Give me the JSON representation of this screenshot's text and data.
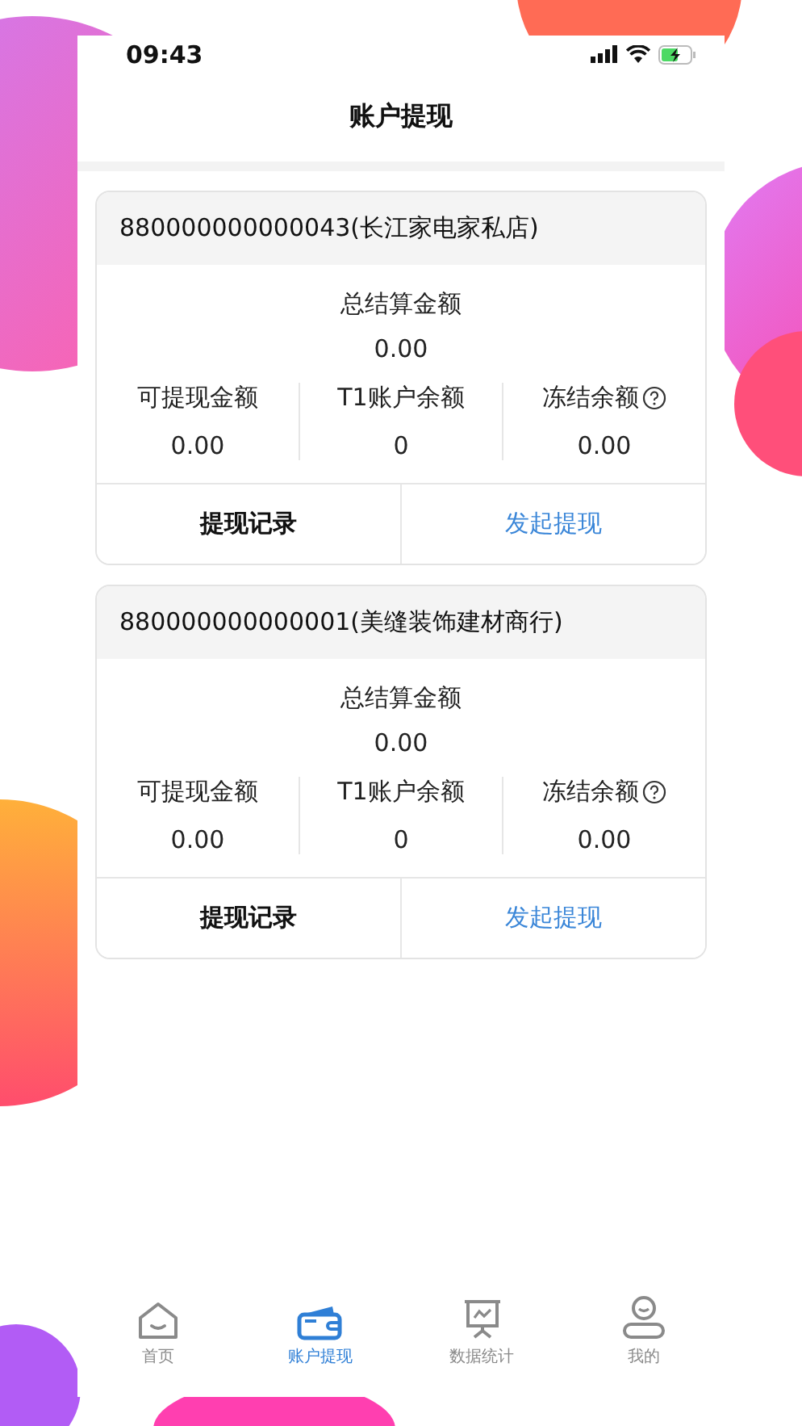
{
  "status_bar": {
    "time": "09:43"
  },
  "header": {
    "title": "账户提现"
  },
  "accounts": [
    {
      "name": "880000000000043(长江家电家私店)",
      "total_label": "总结算金额",
      "total_value": "0.00",
      "stats": [
        {
          "label": "可提现金额",
          "value": "0.00",
          "help": false
        },
        {
          "label": "T1账户余额",
          "value": "0",
          "help": false
        },
        {
          "label": "冻结余额",
          "value": "0.00",
          "help": true
        }
      ],
      "actions": [
        {
          "label": "提现记录",
          "primary": false
        },
        {
          "label": "发起提现",
          "primary": true
        }
      ]
    },
    {
      "name": "880000000000001(美缝装饰建材商行)",
      "total_label": "总结算金额",
      "total_value": "0.00",
      "stats": [
        {
          "label": "可提现金额",
          "value": "0.00",
          "help": false
        },
        {
          "label": "T1账户余额",
          "value": "0",
          "help": false
        },
        {
          "label": "冻结余额",
          "value": "0.00",
          "help": true
        }
      ],
      "actions": [
        {
          "label": "提现记录",
          "primary": false
        },
        {
          "label": "发起提现",
          "primary": true
        }
      ]
    }
  ],
  "tab_bar": [
    {
      "label": "首页",
      "kind": "home",
      "selected": false
    },
    {
      "label": "账户提现",
      "kind": "wallet",
      "selected": true
    },
    {
      "label": "数据统计",
      "kind": "chart",
      "selected": false
    },
    {
      "label": "我的",
      "kind": "user",
      "selected": false
    }
  ]
}
